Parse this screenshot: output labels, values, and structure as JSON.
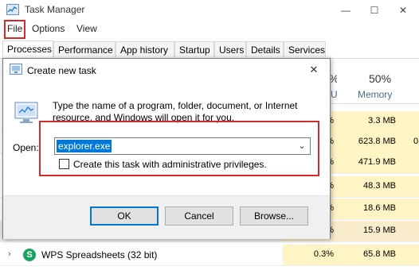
{
  "window": {
    "title": "Task Manager",
    "controls": [
      "—",
      "☐",
      "✕"
    ]
  },
  "menu": [
    "File",
    "Options",
    "View"
  ],
  "tabs": [
    "Processes",
    "Performance",
    "App history",
    "Startup",
    "Users",
    "Details",
    "Services"
  ],
  "columns": {
    "cpu_pct": "%",
    "cpu_label": "U",
    "mem_pct": "50%",
    "mem_label": "Memory"
  },
  "rows": [
    {
      "cpu": "%",
      "mem": "3.3 MB",
      "extra": ""
    },
    {
      "cpu": "%",
      "mem": "623.8 MB",
      "extra": "0"
    },
    {
      "cpu": "%",
      "mem": "471.9 MB",
      "extra": ""
    },
    {
      "cpu": "%",
      "mem": "48.3 MB",
      "extra": ""
    },
    {
      "cpu": "%",
      "mem": "18.6 MB",
      "extra": ""
    },
    {
      "cpu": "%",
      "mem": "15.9 MB",
      "extra": ""
    },
    {
      "name": "WPS Spreadsheets (32 bit)",
      "cpu": "0.3%",
      "mem": "65.8 MB",
      "extra": ""
    }
  ],
  "dialog": {
    "title": "Create new task",
    "description": "Type the name of a program, folder, document, or Internet resource, and Windows will open it for you.",
    "open_label": "Open:",
    "open_value": "explorer.exe",
    "admin_checkbox_label": "Create this task with administrative privileges.",
    "admin_checked": false,
    "ok_label": "OK",
    "cancel_label": "Cancel",
    "browse_label": "Browse..."
  },
  "colors": {
    "highlight_box": "#d62a2a",
    "selection": "#0078d7",
    "heat_cell": "#fff4c4"
  }
}
